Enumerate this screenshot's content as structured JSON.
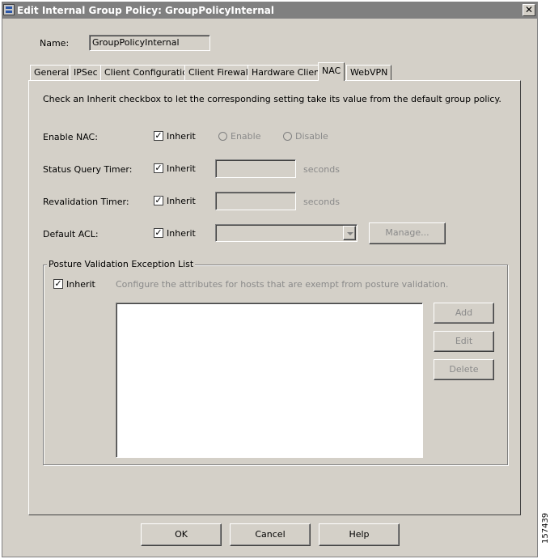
{
  "window": {
    "title": "Edit Internal Group Policy: GroupPolicyInternal",
    "close_glyph": "✕"
  },
  "name_field": {
    "label": "Name:",
    "value": "GroupPolicyInternal"
  },
  "tabs": [
    {
      "label": "General"
    },
    {
      "label": "IPSec"
    },
    {
      "label": "Client Configuration"
    },
    {
      "label": "Client Firewall"
    },
    {
      "label": "Hardware Client"
    },
    {
      "label": "NAC",
      "active": true
    },
    {
      "label": "WebVPN"
    }
  ],
  "instruction": "Check an Inherit checkbox to let the corresponding setting take its value from the default group policy.",
  "inherit_label": "Inherit",
  "check_glyph": "✓",
  "enable_nac": {
    "label": "Enable NAC:",
    "inherit": true,
    "enable_label": "Enable",
    "disable_label": "Disable"
  },
  "status_query_timer": {
    "label": "Status Query Timer:",
    "inherit": true,
    "value": "",
    "unit": "seconds"
  },
  "revalidation_timer": {
    "label": "Revalidation Timer:",
    "inherit": true,
    "value": "",
    "unit": "seconds"
  },
  "default_acl": {
    "label": "Default ACL:",
    "inherit": true,
    "selected": "",
    "manage_label": "Manage..."
  },
  "posture": {
    "group_label": "Posture Validation Exception List",
    "inherit": true,
    "description": "Configure the attributes for hosts that are exempt from posture validation.",
    "add_label": "Add",
    "edit_label": "Edit",
    "delete_label": "Delete"
  },
  "footer": {
    "ok_label": "OK",
    "cancel_label": "Cancel",
    "help_label": "Help"
  },
  "figure_id": "157439"
}
